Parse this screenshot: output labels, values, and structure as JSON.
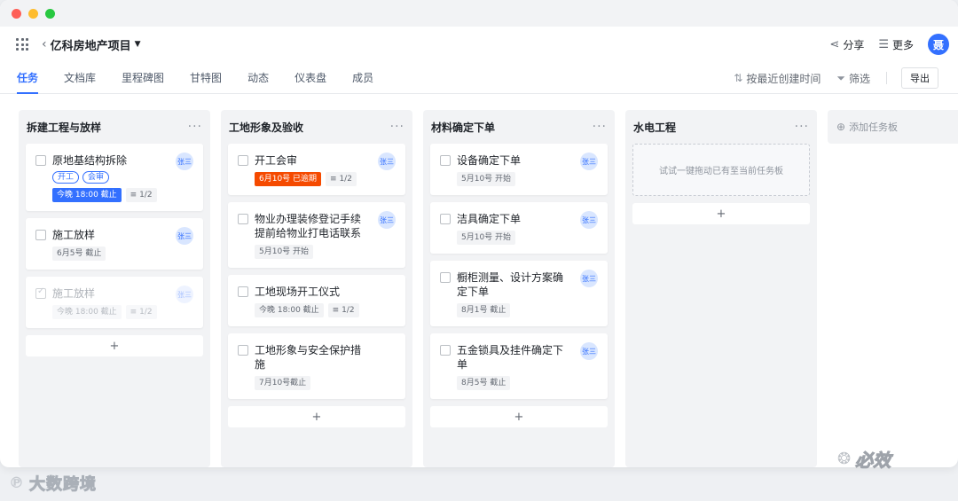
{
  "header": {
    "project_title": "亿科房地产项目",
    "share_label": "分享",
    "more_label": "更多",
    "avatar_initial": "聂"
  },
  "tabs": [
    {
      "label": "任务",
      "active": true
    },
    {
      "label": "文档库"
    },
    {
      "label": "里程碑图"
    },
    {
      "label": "甘特图"
    },
    {
      "label": "动态"
    },
    {
      "label": "仪表盘"
    },
    {
      "label": "成员"
    }
  ],
  "toolbar": {
    "sort_label": "按最近创建时间",
    "filter_label": "筛选",
    "export_label": "导出"
  },
  "columns": [
    {
      "title": "拆建工程与放样",
      "cards": [
        {
          "title": "原地基结构拆除",
          "assignee": "张三",
          "tags": [
            "开工",
            "会审"
          ],
          "chip": "今晚 18:00 截止",
          "subtask": "1/2"
        },
        {
          "title": "施工放样",
          "assignee": "张三",
          "chip": "6月5号 截止"
        },
        {
          "title": "施工放样",
          "assignee": "张三",
          "chip": "今晚 18:00 截止",
          "subtask": "1/2"
        }
      ],
      "add_label": "+"
    },
    {
      "title": "工地形象及验收",
      "cards": [
        {
          "title": "开工会审",
          "assignee": "张三",
          "chip": "6月10号 已逾期",
          "subtask": "1/2"
        },
        {
          "title": "物业办理装修登记手续提前给物业打电话联系",
          "assignee": "张三",
          "chip": "5月10号 开始"
        },
        {
          "title": "工地现场开工仪式",
          "chip": "今晚 18:00 截止",
          "subtask": "1/2"
        },
        {
          "title": "工地形象与安全保护措施",
          "chip": "7月10号截止"
        }
      ],
      "add_label": "+"
    },
    {
      "title": "材料确定下单",
      "cards": [
        {
          "title": "设备确定下单",
          "assignee": "张三",
          "chip": "5月10号 开始"
        },
        {
          "title": "洁具确定下单",
          "assignee": "张三",
          "chip": "5月10号 开始"
        },
        {
          "title": "橱柜测量、设计方案确定下单",
          "assignee": "张三",
          "chip": "8月1号 截止"
        },
        {
          "title": "五金锁具及挂件确定下单",
          "assignee": "张三",
          "chip": "8月5号 截止"
        }
      ],
      "add_label": "+"
    },
    {
      "title": "水电工程",
      "placeholder": "试试一键拖动已有至当前任务板",
      "add_label": "+"
    }
  ],
  "add_board_label": "添加任务板",
  "watermarks": {
    "left": "大数跨境",
    "right": "必效"
  },
  "colors": {
    "accent": "#3370ff",
    "overdue": "#f54a00"
  }
}
